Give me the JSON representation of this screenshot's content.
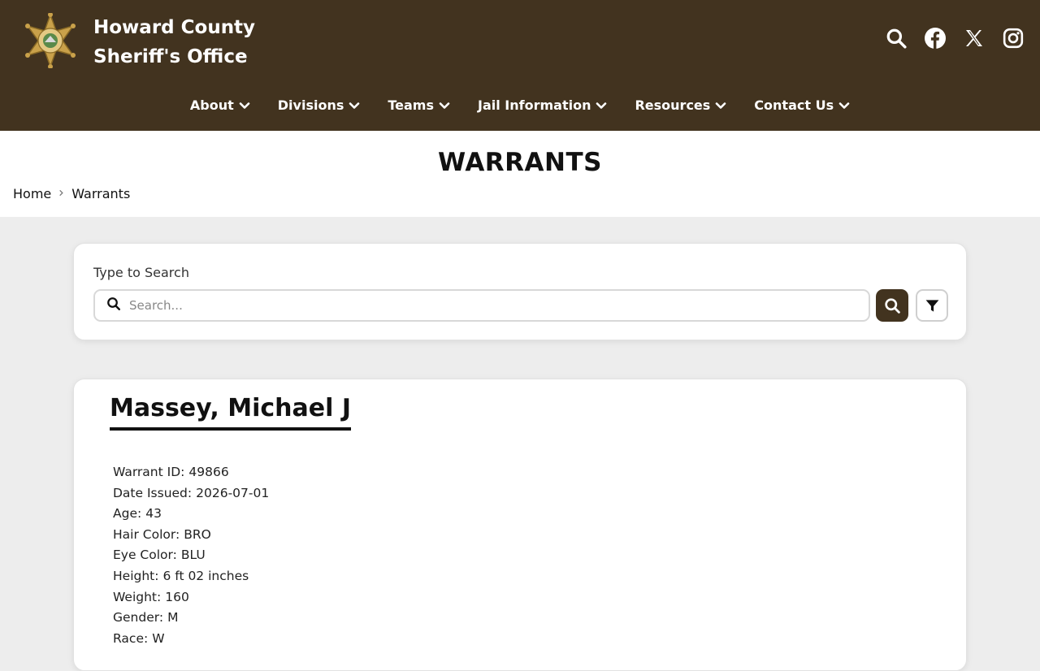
{
  "header": {
    "title_line1": "Howard County",
    "title_line2": "Sheriff's Office",
    "colors": {
      "brand": "#42331f",
      "text": "#ffffff"
    },
    "icons": [
      "search-icon",
      "facebook-icon",
      "x-icon",
      "instagram-icon"
    ]
  },
  "nav": {
    "items": [
      {
        "label": "About"
      },
      {
        "label": "Divisions"
      },
      {
        "label": "Teams"
      },
      {
        "label": "Jail Information"
      },
      {
        "label": "Resources"
      },
      {
        "label": "Contact Us"
      }
    ]
  },
  "page": {
    "title": "WARRANTS",
    "breadcrumb": {
      "home": "Home",
      "current": "Warrants"
    }
  },
  "search": {
    "label": "Type to Search",
    "placeholder": "Search...",
    "value": ""
  },
  "warrant": {
    "name": "Massey, Michael J",
    "fields": [
      {
        "key": "Warrant ID:",
        "value": "49866"
      },
      {
        "key": "Date Issued:",
        "value": "2026-07-01"
      },
      {
        "key": "Age:",
        "value": "43"
      },
      {
        "key": "Hair Color:",
        "value": "BRO"
      },
      {
        "key": "Eye Color:",
        "value": "BLU"
      },
      {
        "key": "Height:",
        "value": "6 ft 02 inches"
      },
      {
        "key": "Weight:",
        "value": "160"
      },
      {
        "key": "Gender:",
        "value": "M"
      },
      {
        "key": "Race:",
        "value": "W"
      }
    ]
  }
}
